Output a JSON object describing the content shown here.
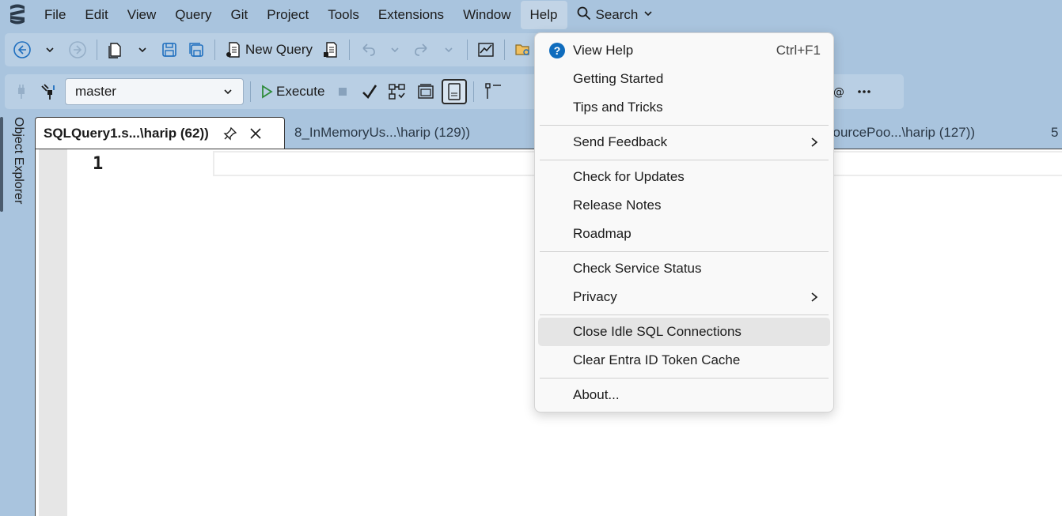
{
  "menubar": {
    "items": [
      "File",
      "Edit",
      "View",
      "Query",
      "Git",
      "Project",
      "Tools",
      "Extensions",
      "Window",
      "Help"
    ],
    "search_label": "Search"
  },
  "toolbar1": {
    "new_query_label": "New Query"
  },
  "toolbar2": {
    "database": "master",
    "execute_label": "Execute"
  },
  "sidebar": {
    "object_explorer_label": "Object Explorer"
  },
  "tabs": [
    {
      "label": "SQLQuery1.s...\\harip (62))"
    },
    {
      "label": "8_InMemoryUs...\\harip (129))"
    },
    {
      "label": "sourcePoo...\\harip (127))"
    },
    {
      "label": "5"
    }
  ],
  "editor": {
    "line_number": "1"
  },
  "help_menu": {
    "view_help": "View Help",
    "view_help_shortcut": "Ctrl+F1",
    "getting_started": "Getting Started",
    "tips_and_tricks": "Tips and Tricks",
    "send_feedback": "Send Feedback",
    "check_for_updates": "Check for Updates",
    "release_notes": "Release Notes",
    "roadmap": "Roadmap",
    "check_service_status": "Check Service Status",
    "privacy": "Privacy",
    "close_idle_sql": "Close Idle SQL Connections",
    "clear_entra": "Clear Entra ID Token Cache",
    "about": "About..."
  },
  "colors": {
    "chrome_bg": "#a9c4de",
    "accent_blue": "#0f6cbd",
    "execute_green": "#2e8b3a"
  }
}
